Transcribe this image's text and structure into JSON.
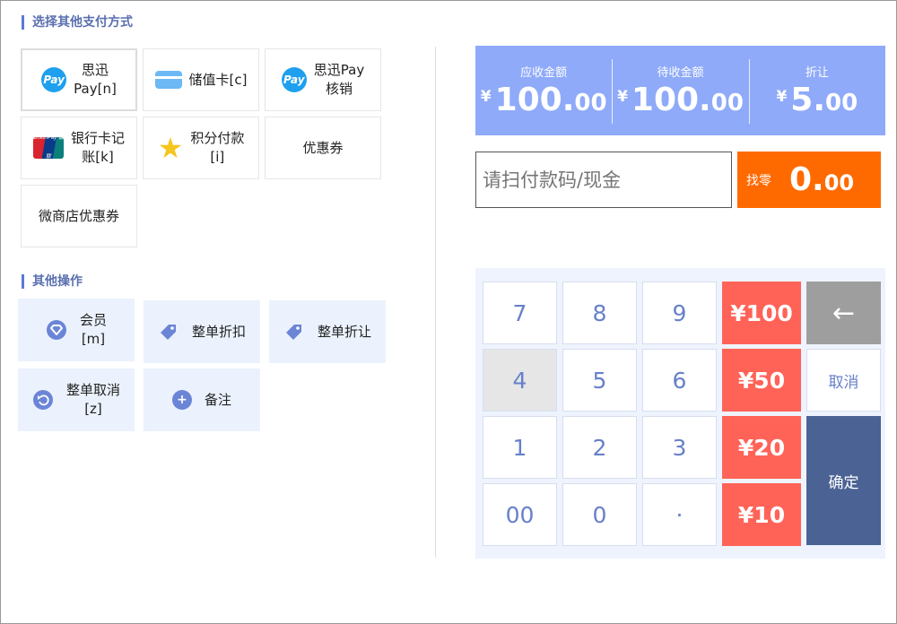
{
  "sections": {
    "payment_title": "选择其他支付方式",
    "operations_title": "其他操作"
  },
  "payment_methods": [
    {
      "label": "思迅\nPay[n]",
      "icon": "pay-icon",
      "icon_text": "Pay"
    },
    {
      "label": "储值卡[c]",
      "icon": "card-icon"
    },
    {
      "label": "思迅Pay\n核销",
      "icon": "pay-icon",
      "icon_text": "Pay"
    },
    {
      "label": "银行卡记\n账[k]",
      "icon": "unionpay-icon",
      "icon_text": "UnionPay 银联"
    },
    {
      "label": "积分付款\n[i]",
      "icon": "star-icon"
    },
    {
      "label": "优惠券"
    },
    {
      "label": "微商店优惠券"
    }
  ],
  "operations": [
    {
      "label": "会员\n[m]",
      "icon": "member-diamond-icon"
    },
    {
      "label": "整单折扣",
      "icon": "tag-icon"
    },
    {
      "label": "整单折让",
      "icon": "tag-icon"
    },
    {
      "label": "整单取消\n[z]",
      "icon": "undo-icon"
    },
    {
      "label": "备注",
      "icon": "plus-icon"
    }
  ],
  "summary": {
    "currency": "¥",
    "receivable_label": "应收金额",
    "receivable_int": "100.",
    "receivable_dec": "00",
    "pending_label": "待收金额",
    "pending_int": "100.",
    "pending_dec": "00",
    "discount_label": "折让",
    "discount_int": "5.",
    "discount_dec": "00"
  },
  "payment_input": {
    "placeholder": "请扫付款码/现金",
    "value": ""
  },
  "change": {
    "label": "找零",
    "int": "0.",
    "dec": "00"
  },
  "keypad": {
    "digits": [
      "7",
      "8",
      "9",
      "4",
      "5",
      "6",
      "1",
      "2",
      "3",
      "00",
      "0",
      "·"
    ],
    "money": [
      "¥100",
      "¥50",
      "¥20",
      "¥10"
    ],
    "backspace": "←",
    "cancel": "取消",
    "confirm": "确定",
    "pressed_key": "4"
  },
  "colors": {
    "summary_bg": "#8faaf9",
    "change_bg": "#ff6a00",
    "money_key": "#ff6358",
    "confirm_key": "#4b6294",
    "accent": "#5a7ad8"
  }
}
